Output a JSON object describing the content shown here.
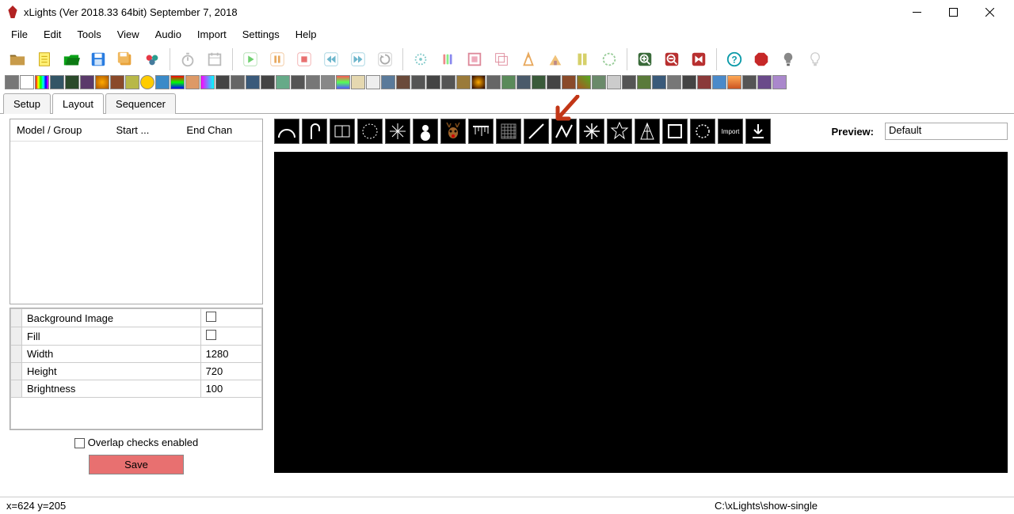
{
  "titlebar": {
    "title": "xLights  (Ver 2018.33 64bit) September 7, 2018"
  },
  "menu": {
    "items": [
      "File",
      "Edit",
      "Tools",
      "View",
      "Audio",
      "Import",
      "Settings",
      "Help"
    ]
  },
  "tabs": {
    "items": [
      "Setup",
      "Layout",
      "Sequencer"
    ],
    "active": 1
  },
  "modellist": {
    "cols": [
      "Model / Group",
      "Start ...",
      "End Chan"
    ]
  },
  "props": {
    "background_image": {
      "label": "Background Image",
      "value": ""
    },
    "fill": {
      "label": "Fill",
      "checked": false
    },
    "width": {
      "label": "Width",
      "value": "1280"
    },
    "height": {
      "label": "Height",
      "value": "720"
    },
    "brightness": {
      "label": "Brightness",
      "value": "100"
    }
  },
  "overlap": {
    "label": "Overlap checks enabled",
    "checked": false
  },
  "save_label": "Save",
  "preview": {
    "label": "Preview:",
    "value": "Default"
  },
  "model_buttons": [
    "arch",
    "candycane",
    "window",
    "circle",
    "snowflake",
    "snowman",
    "reindeer",
    "icicles",
    "matrix",
    "line",
    "polyline",
    "spinner",
    "star",
    "tree",
    "cube",
    "wreath",
    "import",
    "download"
  ],
  "statusbar": {
    "coords": "x=624 y=205",
    "path": "C:\\xLights\\show-single"
  }
}
